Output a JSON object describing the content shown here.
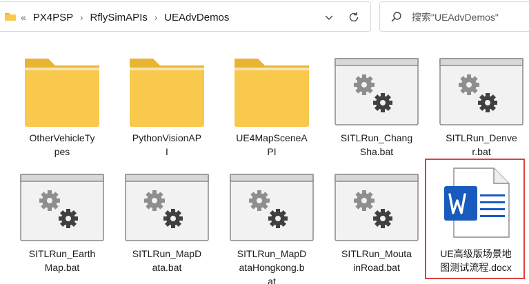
{
  "address_bar": {
    "overflow": "«",
    "crumbs": [
      "PX4PSP",
      "RflySimAPIs",
      "UEAdvDemos"
    ],
    "separator": "›"
  },
  "search": {
    "placeholder": "搜索\"UEAdvDemos\""
  },
  "files": [
    {
      "kind": "folder",
      "line1": "OtherVehicleTy",
      "line2": "pes",
      "line3": ""
    },
    {
      "kind": "folder",
      "line1": "PythonVisionAP",
      "line2": "I",
      "line3": ""
    },
    {
      "kind": "folder",
      "line1": "UE4MapSceneA",
      "line2": "PI",
      "line3": ""
    },
    {
      "kind": "bat",
      "line1": "SITLRun_Chang",
      "line2": "Sha.bat",
      "line3": ""
    },
    {
      "kind": "bat",
      "line1": "SITLRun_Denve",
      "line2": "r.bat",
      "line3": ""
    },
    {
      "kind": "bat",
      "line1": "SITLRun_Earth",
      "line2": "Map.bat",
      "line3": ""
    },
    {
      "kind": "bat",
      "line1": "SITLRun_MapD",
      "line2": "ata.bat",
      "line3": ""
    },
    {
      "kind": "bat",
      "line1": "SITLRun_MapD",
      "line2": "ataHongkong.b",
      "line3": "at"
    },
    {
      "kind": "bat",
      "line1": "SITLRun_Mouta",
      "line2": "inRoad.bat",
      "line3": ""
    },
    {
      "kind": "docx",
      "line1": "UE高级版场景地",
      "line2": "图测试流程.docx",
      "line3": ""
    }
  ],
  "colors": {
    "folder_body": "#f8c94c",
    "folder_tab": "#e9b432",
    "word_blue": "#185abd",
    "selection_border": "#d9413c"
  },
  "icons": {
    "folder": "folder-icon",
    "bat": "gear-batch-icon",
    "docx": "word-document-icon"
  }
}
